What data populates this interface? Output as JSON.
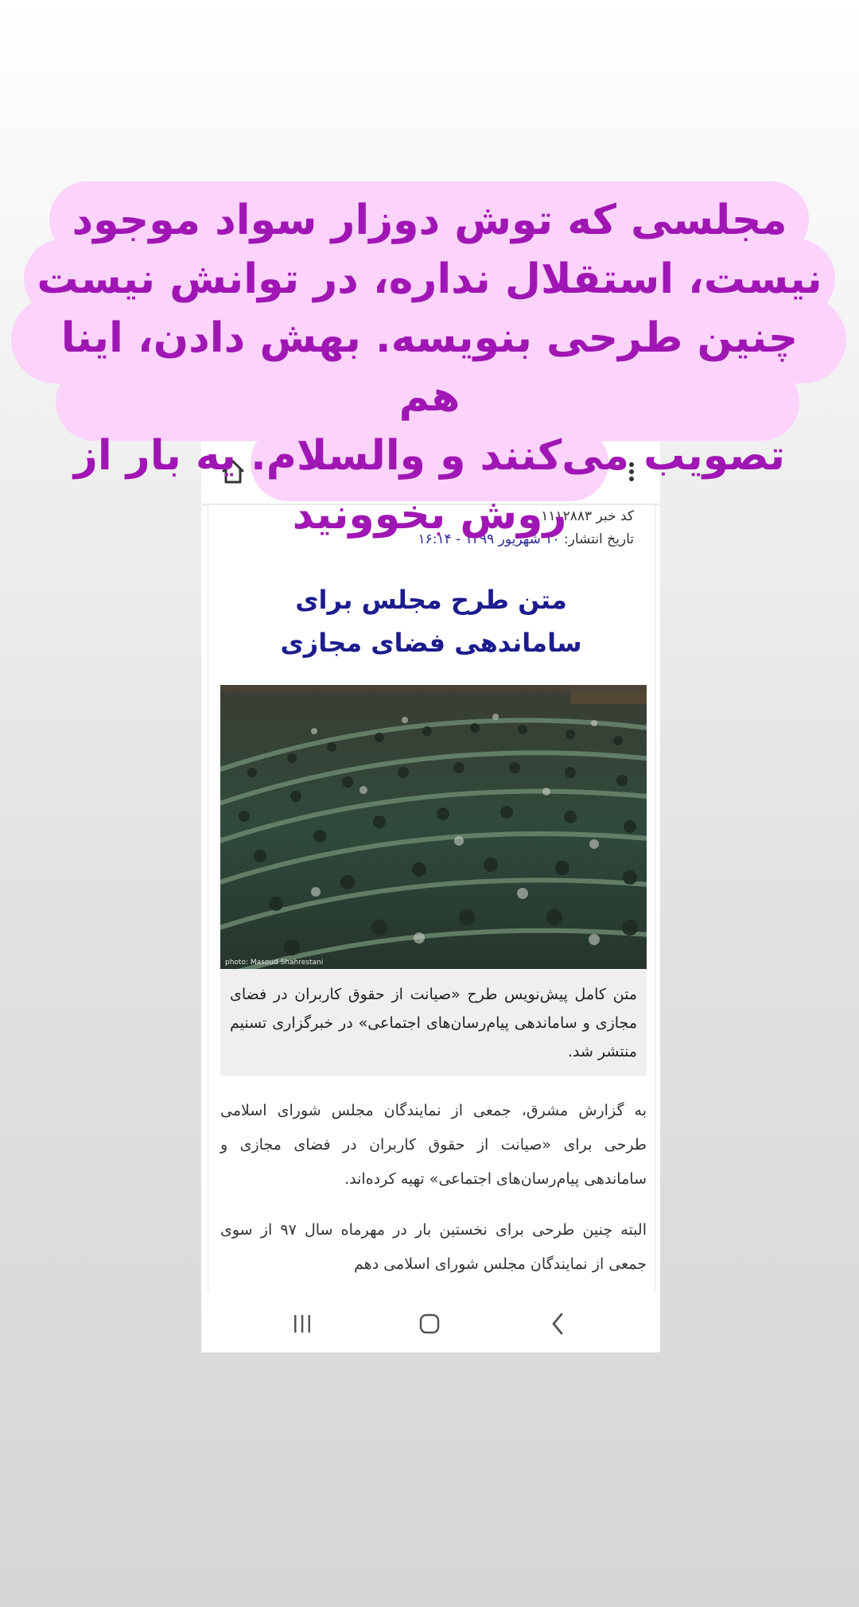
{
  "overlay_caption": {
    "lines": [
      "مجلسی که توش دوزار سواد موجود",
      "نیست، استقلال نداره، در توانش نیست",
      "چنین طرحی بنویسه. بهش دادن، اینا هم",
      "تصویب می‌کنند و والسلام. یه بار از",
      "روش بخوونید"
    ]
  },
  "browser": {
    "home_icon": "home-icon",
    "more_icon": "more-vertical-icon"
  },
  "article": {
    "news_code": "کد خبر ۱۱۱۲۸۸۳",
    "published_label": "تاریخ انتشار: ",
    "published_date": "۱۰ شهریور ۱۳۹۹ - ۱۶:۱۴",
    "title": "متن طرح مجلس برای ساماندهی فضای مجازی",
    "photo_credit": "photo: Masoud Shahrestani",
    "lead": "متن کامل پیش‌نویس طرح «صیانت از حقوق کاربران در فضای مجازی و ساماندهی پیام‌رسان‌های اجتماعی» در خبرگزاری تسنیم منتشر شد.",
    "paragraph_1": "به گزارش مشرق، جمعی از نمایندگان مجلس شورای اسلامی طرحی برای «صیانت از حقوق کاربران در فضای مجازی و ساماندهی پیام‌رسان‌های اجتماعی» تهیه کرده‌اند.",
    "paragraph_2": "البته چنین طرحی برای نخستین بار در مهرماه سال ۹۷ از سوی جمعی از نمایندگان مجلس شورای اسلامی دهم"
  },
  "navigation": {
    "recent_icon": "recent-apps-icon",
    "home_icon": "home-circle-icon",
    "back_icon": "back-icon"
  },
  "colors": {
    "overlay_bubble": "#fbd3fb",
    "overlay_text": "#a016b4",
    "title": "#1c1c8e"
  }
}
